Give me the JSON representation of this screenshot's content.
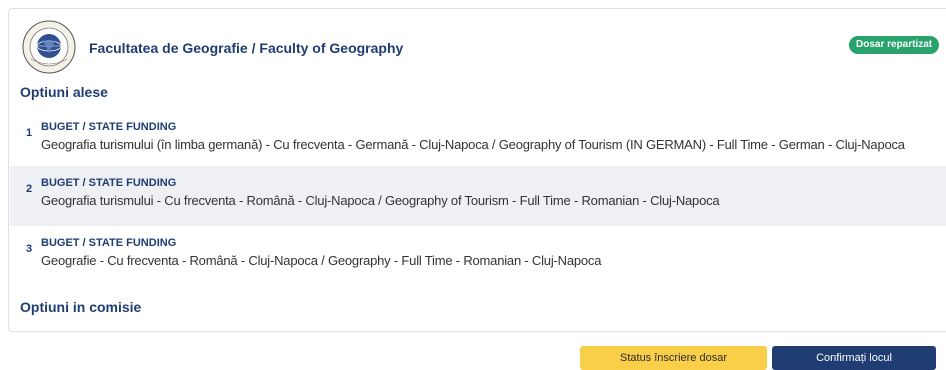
{
  "header": {
    "faculty_title": "Facultatea de Geografie / Faculty of Geography",
    "status_badge": "Dosar repartizat",
    "logo_text_top": "UNIVERSITAS BABEȘ-BOLYAI",
    "logo_text_bottom": "ROMANIA"
  },
  "chosen_options": {
    "title": "Optiuni alese",
    "items": [
      {
        "number": "1",
        "type": "BUGET / STATE FUNDING",
        "description": "Geografia turismului (în limba germană) - Cu frecventa - Germană - Cluj-Napoca / Geography of Tourism (IN GERMAN) - Full Time - German - Cluj-Napoca"
      },
      {
        "number": "2",
        "type": "BUGET / STATE FUNDING",
        "description": "Geografia turismului - Cu frecventa - Română - Cluj-Napoca / Geography of Tourism - Full Time - Romanian - Cluj-Napoca"
      },
      {
        "number": "3",
        "type": "BUGET / STATE FUNDING",
        "description": "Geografie - Cu frecventa - Română - Cluj-Napoca / Geography - Full Time - Romanian - Cluj-Napoca"
      }
    ]
  },
  "committee_options": {
    "title": "Optiuni in comisie"
  },
  "actions": {
    "status_label": "Status înscriere dosar",
    "confirm_label": "Confirmați locul"
  },
  "colors": {
    "primary": "#1f3d73",
    "badge": "#28a36b",
    "status_button": "#f9cf4a",
    "alt_row": "#eef0f3"
  }
}
